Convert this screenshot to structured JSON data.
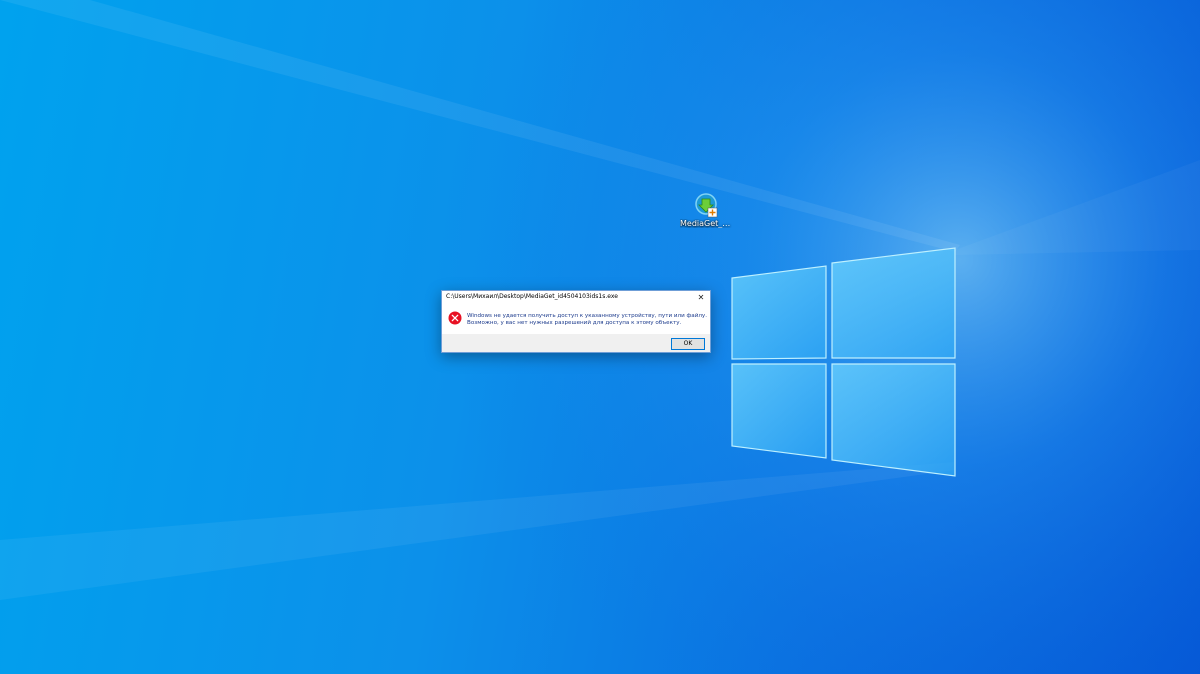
{
  "desktop": {
    "icons": [
      {
        "label": "MediaGet_i...",
        "icon": "mediaget-shortcut-icon"
      }
    ]
  },
  "dialog": {
    "title": "C:\\Users\\Михаил\\Desktop\\MediaGet_id4504103ids1s.exe",
    "close_glyph": "✕",
    "icon": "error-icon",
    "message_line1": "Windows не удается получить доступ к указанному устройству, пути или файлу.",
    "message_line2": "Возможно, у вас нет нужных разрешений для доступа к этому объекту.",
    "ok_label": "OK"
  },
  "colors": {
    "desktop_blue": "#0c90ea",
    "error_red": "#e81123",
    "accent": "#0078d7"
  }
}
